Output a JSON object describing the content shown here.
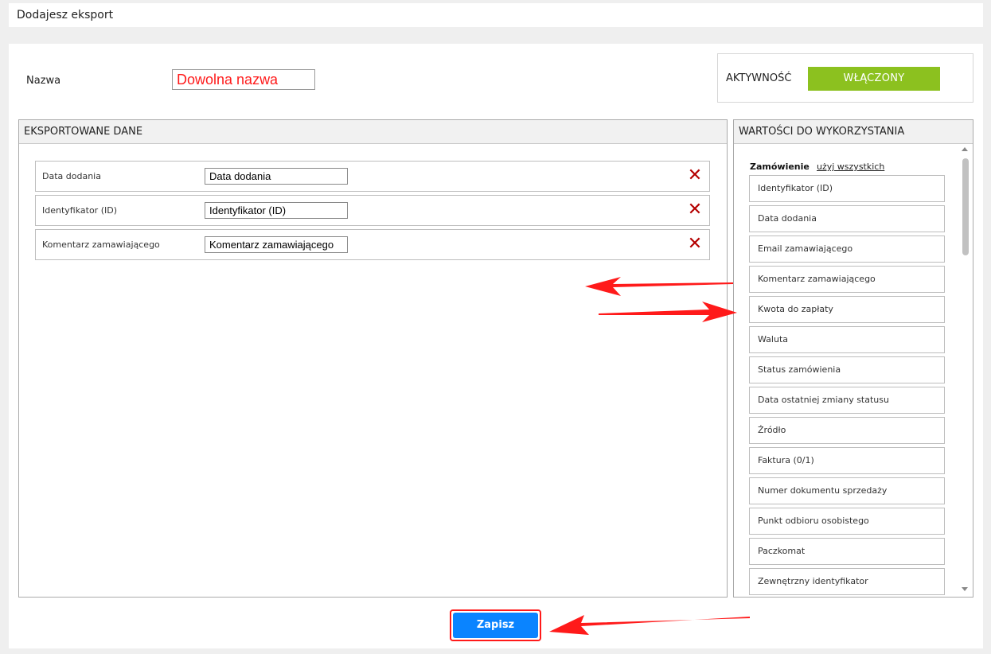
{
  "header": {
    "title": "Dodajesz eksport"
  },
  "form": {
    "name_label": "Nazwa",
    "name_value": "Dowolna nazwa",
    "activity_label": "AKTYWNOŚĆ",
    "activity_state": "WŁĄCZONY"
  },
  "exported": {
    "title": "EKSPORTOWANE DANE",
    "rows": [
      {
        "label": "Data dodania",
        "value": "Data dodania"
      },
      {
        "label": "Identyfikator (ID)",
        "value": "Identyfikator (ID)"
      },
      {
        "label": "Komentarz zamawiającego",
        "value": "Komentarz zamawiającego"
      }
    ]
  },
  "values": {
    "title": "WARTOŚCI DO WYKORZYSTANIA",
    "group_title": "Zamówienie",
    "use_all_label": "użyj wszystkich",
    "items": [
      "Identyfikator (ID)",
      "Data dodania",
      "Email zamawiającego",
      "Komentarz zamawiającego",
      "Kwota do zapłaty",
      "Waluta",
      "Status zamówienia",
      "Data ostatniej zmiany statusu",
      "Źródło",
      "Faktura (0/1)",
      "Numer dokumentu sprzedaży",
      "Punkt odbioru osobistego",
      "Paczkomat",
      "Zewnętrzny identyfikator"
    ]
  },
  "actions": {
    "save_label": "Zapisz"
  },
  "colors": {
    "toggle_on": "#8cc11f",
    "save_button": "#0a84ff",
    "delete_icon": "#b40000",
    "annotation_arrow": "#ff1a1a"
  }
}
